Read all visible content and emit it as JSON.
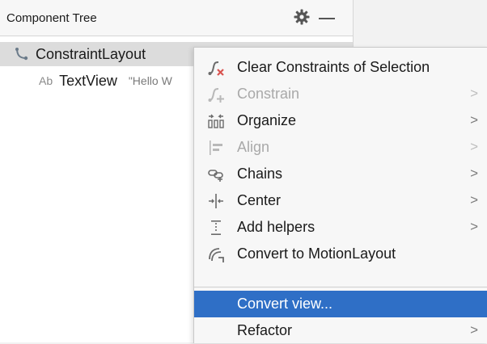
{
  "panel": {
    "title": "Component Tree",
    "gear_icon": "gear-icon",
    "minimize_icon": "minus-icon"
  },
  "tree": {
    "root": {
      "label": "ConstraintLayout",
      "icon": "constraint-layout-icon"
    },
    "child": {
      "badge": "Ab",
      "label": "TextView",
      "text_value": "\"Hello W"
    }
  },
  "menu": {
    "items": [
      {
        "label": "Clear Constraints of Selection",
        "icon": "clear-constraints-icon",
        "submenu": false,
        "enabled": true
      },
      {
        "label": "Constrain",
        "icon": "constrain-icon",
        "submenu": true,
        "enabled": false
      },
      {
        "label": "Organize",
        "icon": "organize-icon",
        "submenu": true,
        "enabled": true
      },
      {
        "label": "Align",
        "icon": "align-icon",
        "submenu": true,
        "enabled": false
      },
      {
        "label": "Chains",
        "icon": "chains-icon",
        "submenu": true,
        "enabled": true
      },
      {
        "label": "Center",
        "icon": "center-icon",
        "submenu": true,
        "enabled": true
      },
      {
        "label": "Add helpers",
        "icon": "add-helpers-icon",
        "submenu": true,
        "enabled": true
      },
      {
        "label": "Convert to MotionLayout",
        "icon": "motion-layout-icon",
        "submenu": false,
        "enabled": true
      },
      {
        "label": "Convert view...",
        "submenu": false,
        "enabled": true,
        "selected": true
      },
      {
        "label": "Refactor",
        "submenu": true,
        "enabled": true
      }
    ],
    "chevron": ">"
  },
  "colors": {
    "selection_blue": "#2f6fc6",
    "tree_selection_gray": "#dcdcdc",
    "clear_red": "#d9534f",
    "icon_gray": "#6b6b6b"
  }
}
